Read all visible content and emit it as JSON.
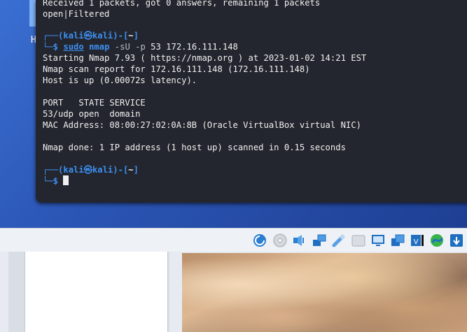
{
  "desktop": {
    "partial_label": "H"
  },
  "terminal": {
    "lines": {
      "l0": "Received 1 packets, got 0 answers, remaining 1 packets",
      "l1": "open|Filtered",
      "prompt1_user": "kali",
      "prompt1_at": "㉿",
      "prompt1_host": "kali",
      "prompt1_path": "~",
      "cmd_sudo": "sudo",
      "cmd_rest": "nmap",
      "cmd_args": "-sU -p",
      "cmd_tail": "53 172.16.111.148",
      "l3": "Starting Nmap 7.93 ( https://nmap.org ) at 2023-01-02 14:21 EST",
      "l4": "Nmap scan report for 172.16.111.148 (172.16.111.148)",
      "l5": "Host is up (0.00072s latency).",
      "l6": "PORT   STATE SERVICE",
      "l7": "53/udp open  domain",
      "l8": "MAC Address: 08:00:27:02:0A:8B (Oracle VirtualBox virtual NIC)",
      "l9": "Nmap done: 1 IP address (1 host up) scanned in 0.15 seconds",
      "prompt2_user": "kali",
      "prompt2_at": "㉿",
      "prompt2_host": "kali",
      "prompt2_path": "~"
    }
  },
  "statusbar": {
    "icons": [
      "hard-disk-icon",
      "optical-disk-icon",
      "audio-icon",
      "network-icon",
      "usb-icon",
      "shared-folder-icon",
      "display-icon",
      "video-capture-icon",
      "recording-icon",
      "guest-additions-icon",
      "host-key-icon"
    ]
  }
}
